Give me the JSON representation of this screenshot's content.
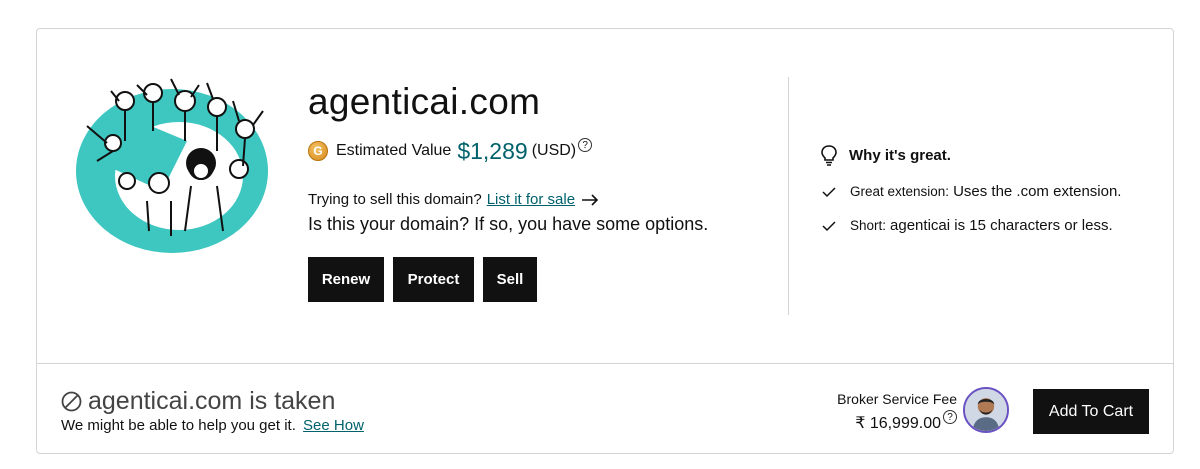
{
  "domain": {
    "name": "agenticai.com"
  },
  "estimate": {
    "coin_letter": "G",
    "label": "Estimated Value",
    "value": "$1,289",
    "currency": "(USD)",
    "help": "?"
  },
  "sell": {
    "prompt": "Trying to sell this domain?",
    "link": "List it for sale",
    "options": "Is this your domain? If so, you have some options."
  },
  "buttons": {
    "renew": "Renew",
    "protect": "Protect",
    "sell": "Sell"
  },
  "why": {
    "title": "Why it's great.",
    "items": [
      {
        "label": "Great extension:",
        "desc": "Uses the .com extension."
      },
      {
        "label": "Short:",
        "desc": "agenticai is 15 characters or less."
      }
    ]
  },
  "taken": {
    "title": "agenticai.com is taken",
    "help": "We might be able to help you get it.",
    "see_how": "See How"
  },
  "broker": {
    "label": "Broker Service Fee",
    "fee": "₹ 16,999.00",
    "help": "?"
  },
  "cart": {
    "label": "Add To Cart"
  },
  "colors": {
    "accent": "#00616b",
    "teal_illustration": "#3ec6c0",
    "button_bg": "#111111",
    "avatar_ring": "#6b52c4"
  },
  "icons": {
    "coin": "coin-icon",
    "help": "help-circle-icon",
    "arrow": "arrow-right-icon",
    "bulb": "lightbulb-icon",
    "check": "check-icon",
    "taken": "prohibited-icon"
  }
}
